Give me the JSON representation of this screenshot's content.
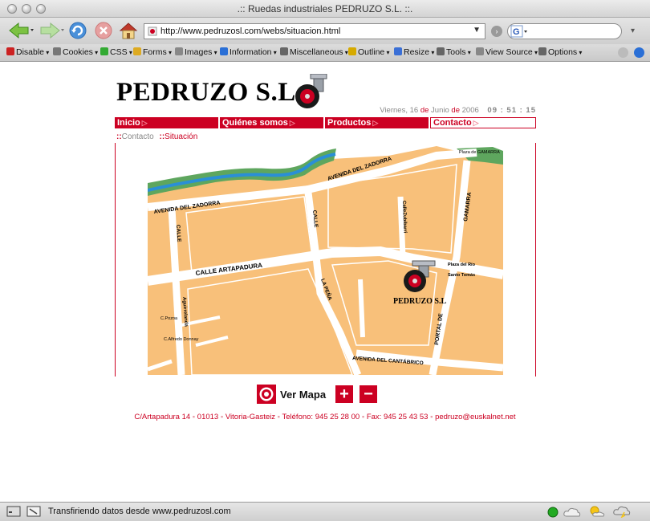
{
  "window": {
    "title": ".:: Ruedas industriales PEDRUZO S.L. ::."
  },
  "navigation": {
    "url": "http://www.pedruzosl.com/webs/situacion.html",
    "search_value": ""
  },
  "devtoolbar": {
    "items": [
      {
        "label": "Disable",
        "icon": "disable-icon",
        "color": "#cc2222"
      },
      {
        "label": "Cookies",
        "icon": "cookie-icon",
        "color": "#777777"
      },
      {
        "label": "CSS",
        "icon": "css-icon",
        "color": "#33aa33"
      },
      {
        "label": "Forms",
        "icon": "forms-icon",
        "color": "#ddaa22"
      },
      {
        "label": "Images",
        "icon": "images-icon",
        "color": "#888888"
      },
      {
        "label": "Information",
        "icon": "information-icon",
        "color": "#2a6fd6"
      },
      {
        "label": "Miscellaneous",
        "icon": "miscellaneous-icon",
        "color": "#666666"
      },
      {
        "label": "Outline",
        "icon": "outline-icon",
        "color": "#d6aa00"
      },
      {
        "label": "Resize",
        "icon": "resize-icon",
        "color": "#3a6fd6"
      },
      {
        "label": "Tools",
        "icon": "tools-icon",
        "color": "#666666"
      },
      {
        "label": "View Source",
        "icon": "view-source-icon",
        "color": "#888888"
      },
      {
        "label": "Options",
        "icon": "options-icon",
        "color": "#666666"
      }
    ]
  },
  "page": {
    "logo": "PEDRUZO S.L.",
    "date": {
      "weekday": "Viernes,",
      "day": "16",
      "de1": "de",
      "month": "Junio",
      "de2": "de",
      "year": "2006",
      "clock": "09 : 51 : 15"
    },
    "menu": [
      {
        "label": "Inicio",
        "active": false
      },
      {
        "label": "Quiénes somos",
        "active": false
      },
      {
        "label": "Productos",
        "active": false
      },
      {
        "label": "Contacto",
        "active": true
      }
    ],
    "breadcrumb": {
      "sep": "::",
      "parent": "Contacto",
      "current": "Situación"
    },
    "map": {
      "labels": {
        "avenida_del_zadorra_top": "AVENIDA DEL ZADORRA",
        "avenida_del_zadorra_left": "AVENIDA DEL ZADORRA",
        "plaza_gamarra": "Plaza de GAMARRA",
        "calle_gamarra": "GAMARRA",
        "calle_zubibarri": "CalleZubibarri",
        "calle_artapadura": "CALLE ARTAPADURA",
        "calle_vertical": "CALLE",
        "calle_left": "CALLE",
        "la_pena": "LA PEÑA",
        "aguirrelanda": "Aguirrelanda",
        "portal_de": "PORTAL DE",
        "plaza_del_rio": "Plaza del Río",
        "santo_tomas": "Santo Tomás",
        "c_pozoa": "C.Pozoa",
        "c_alfredo_donnay": "C.Alfredo Donnay",
        "avenida_del_cantabrico": "AVENIDA DEL CANTÁBRICO",
        "company": "PEDRUZO S.L"
      }
    },
    "ver_mapa": "Ver Mapa",
    "zoom_in": "+",
    "zoom_out": "−",
    "footer": {
      "address": "C/Artapadura 14",
      "postal": "01013",
      "city": "Vitoria-Gasteiz",
      "phone": "Teléfono: 945 25 28 00",
      "fax": "Fax: 945 25 43 53",
      "email": "pedruzo@euskalnet.net"
    }
  },
  "status": {
    "text": "Transfiriendo datos desde www.pedruzosl.com"
  },
  "colors": {
    "brand_red": "#cc0022",
    "map_block": "#f8c07a",
    "river": "#2a8fd6",
    "park": "#5ea65e"
  }
}
